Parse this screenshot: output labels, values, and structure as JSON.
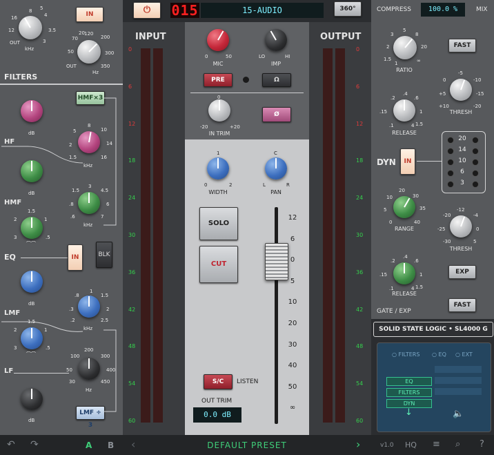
{
  "header": {
    "power_icon": "power-icon",
    "channel_number": "015",
    "channel_name": "15-AUDIO",
    "view_button": "360°",
    "compress_label": "COMPRESS",
    "mix_value": "100.0 %",
    "mix_label": "MIX"
  },
  "filters": {
    "in_button": "IN",
    "hpf_scale": {
      "top": "8",
      "l": "12",
      "r": "4",
      "rr": "3.5",
      "b": "3",
      "out": "OUT",
      "unit": "kHz",
      "s5": "5",
      "s16": "16"
    },
    "lpf_scale": {
      "t": "120",
      "t2": "200",
      "l": "70",
      "l2": "50",
      "r": "300",
      "out": "OUT",
      "b": "350",
      "unit": "Hz",
      "s20": "20"
    },
    "section_label": "FILTERS"
  },
  "eq": {
    "hmf_x3_button": "HMF×3",
    "hf_label": "HF",
    "hmf_label": "HMF",
    "eq_label": "EQ",
    "lmf_label": "LMF",
    "lf_label": "LF",
    "in_button": "IN",
    "blk_button": "BLK",
    "lmf_div3_button": "LMF ÷ 3",
    "db_label": "dB",
    "khz_label": "kHz",
    "hz_label": "Hz",
    "hf_freq_scale": [
      "8",
      "10",
      "14",
      "16",
      "2",
      "1.5",
      "5"
    ],
    "hmf_freq_scale": [
      "3",
      "4.5",
      "6",
      "7",
      ".8",
      ".6",
      "1.5"
    ],
    "q_scale": [
      "1.5",
      "2",
      "1",
      "3",
      ".5"
    ],
    "lmf_freq_scale": [
      ".8",
      "1",
      "1.5",
      "2",
      "2.5",
      ".3",
      ".2"
    ],
    "lf_freq_scale": [
      "200",
      "300",
      "400",
      "450",
      "30",
      "50",
      "100"
    ]
  },
  "center": {
    "input_label": "INPUT",
    "output_label": "OUTPUT",
    "meter_scale": [
      "0",
      "6",
      "12",
      "18",
      "24",
      "30",
      "36",
      "42",
      "48",
      "54",
      "60"
    ],
    "mic_label": "MIC",
    "imp_label": "IMP",
    "mic_scale": {
      "min": "0",
      "max": "50"
    },
    "imp_scale": {
      "lo": "LO",
      "hi": "HI"
    },
    "pre_button": "PRE",
    "omega_button": "Ω",
    "in_trim_label": "IN TRIM",
    "in_trim_scale": {
      "top": "0",
      "l": "-20",
      "r": "+20"
    },
    "phase_button": "Ø",
    "width_label": "WIDTH",
    "width_scale": {
      "top": "1",
      "l": "0",
      "r": "2"
    },
    "pan_label": "PAN",
    "pan_scale": {
      "top": "C",
      "l": "L",
      "r": "R"
    },
    "solo_button": "SOLO",
    "cut_button": "CUT",
    "fader_scale": [
      "12",
      "6",
      "0",
      "5",
      "10",
      "20",
      "30",
      "40",
      "50",
      "∞"
    ],
    "sc_button": "S/C",
    "listen_label": "LISTEN",
    "out_trim_label": "OUT TRIM",
    "out_trim_value": "0.0 dB"
  },
  "dynamics": {
    "ratio_label": "RATIO",
    "ratio_scale": [
      "5",
      "3",
      "8",
      "2",
      "20",
      "1.5",
      "∞",
      "1"
    ],
    "fast_button": "FAST",
    "thresh_label": "THRESH",
    "thresh_scale": [
      "-5",
      "0",
      "-10",
      "+5",
      "-15",
      "+10",
      "-20"
    ],
    "release_label": "RELEASE",
    "release_scale": [
      ".4",
      ".6",
      ".2",
      "1",
      ".15",
      "1.5",
      ".1",
      "4"
    ],
    "dyn_label": "DYN",
    "in_button": "IN",
    "gr_scale": [
      "20",
      "14",
      "10",
      "6",
      "3"
    ],
    "range_label": "RANGE",
    "range_scale": [
      "20",
      "30",
      "10",
      "35",
      "5",
      "40",
      "0"
    ],
    "gate_thresh_label": "THRESH",
    "gate_thresh_scale": [
      "-12",
      "-20",
      "-4",
      "-25",
      "0",
      "-30",
      "5"
    ],
    "exp_button": "EXP",
    "gate_release_label": "RELEASE",
    "gate_release_scale": [
      ".4",
      ".6",
      ".2",
      "1",
      ".15",
      "1.5",
      ".1",
      "4"
    ],
    "gate_exp_label": "GATE / EXP",
    "gate_fast_button": "FAST"
  },
  "brand": {
    "text": "SOLID STATE LOGIC • SL4000 G"
  },
  "routing": {
    "filters_opt": "FILTERS",
    "eq_opt": "EQ",
    "ext_opt": "EXT",
    "slot1": "EQ",
    "slot2": "FILTERS",
    "slot3": "DYN"
  },
  "footer": {
    "undo_icon": "undo-icon",
    "redo_icon": "redo-icon",
    "a_label": "A",
    "b_label": "B",
    "preset_name": "DEFAULT PRESET",
    "version": "v1.0",
    "hq_label": "HQ"
  },
  "colors": {
    "accent_green": "#3fd07a",
    "meter_green": "#35d14d",
    "meter_red": "#e03b3b",
    "led_red": "#ff2020",
    "display_cyan": "#7ef0ff"
  }
}
